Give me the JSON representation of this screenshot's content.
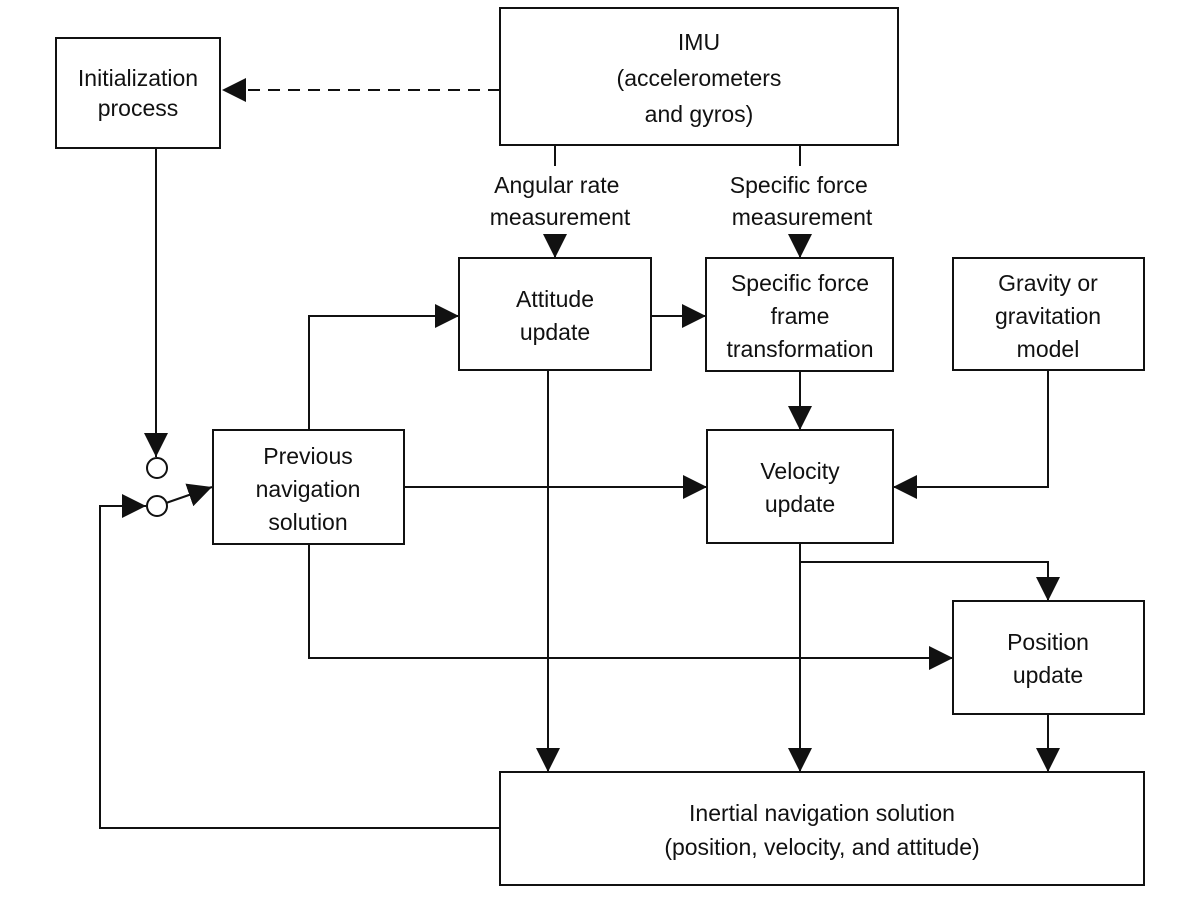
{
  "nodes": {
    "init": {
      "lines": [
        "Initialization",
        "process"
      ]
    },
    "imu": {
      "lines": [
        "IMU",
        "(accelerometers",
        "and gyros)"
      ]
    },
    "attitude": {
      "lines": [
        "Attitude",
        "update"
      ]
    },
    "sf_transform": {
      "lines": [
        "Specific force",
        "frame",
        "transformation"
      ]
    },
    "gravity": {
      "lines": [
        "Gravity or",
        "gravitation",
        "model"
      ]
    },
    "prev_nav": {
      "lines": [
        "Previous",
        "navigation",
        "solution"
      ]
    },
    "velocity": {
      "lines": [
        "Velocity",
        "update"
      ]
    },
    "position": {
      "lines": [
        "Position",
        "update"
      ]
    },
    "ins": {
      "lines": [
        "Inertial navigation solution",
        "(position, velocity, and attitude)"
      ]
    }
  },
  "edge_labels": {
    "angular_rate": [
      "Angular rate",
      "measurement"
    ],
    "specific_force": [
      "Specific force",
      "measurement"
    ]
  }
}
